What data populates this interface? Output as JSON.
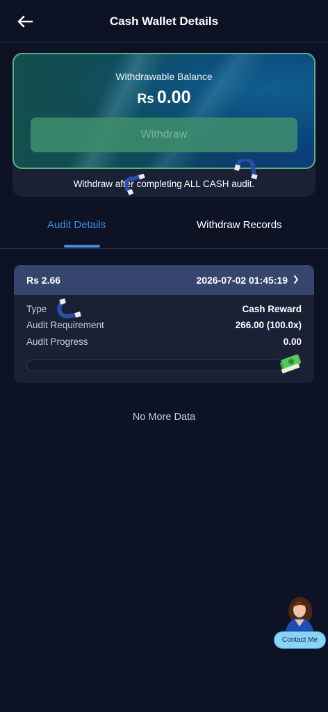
{
  "header": {
    "title": "Cash Wallet Details",
    "back_icon": "back-arrow-icon"
  },
  "balance": {
    "label": "Withdrawable Balance",
    "currency": "Rs",
    "amount": "0.00",
    "withdraw_label": "Withdraw",
    "note": "Withdraw after completing ALL CASH audit."
  },
  "tabs": [
    {
      "label": "Audit Details",
      "active": true
    },
    {
      "label": "Withdraw Records",
      "active": false
    }
  ],
  "records": [
    {
      "amount": "Rs 2.66",
      "time": "2026-07-02 01:45:19",
      "rows": [
        {
          "label": "Type",
          "value": "Cash Reward"
        },
        {
          "label": "Audit Requirement",
          "value": "266.00 (100.0x)"
        },
        {
          "label": "Audit Progress",
          "value": "0.00"
        }
      ],
      "progress": 0
    }
  ],
  "footer": {
    "no_more": "No More Data"
  },
  "contact": {
    "label": "Contact Me"
  },
  "colors": {
    "background": "#0d1324",
    "accent": "#3d8fe6",
    "card": "#1a2135",
    "card_header": "#36456d",
    "withdraw_button": "#3f8f6e"
  }
}
